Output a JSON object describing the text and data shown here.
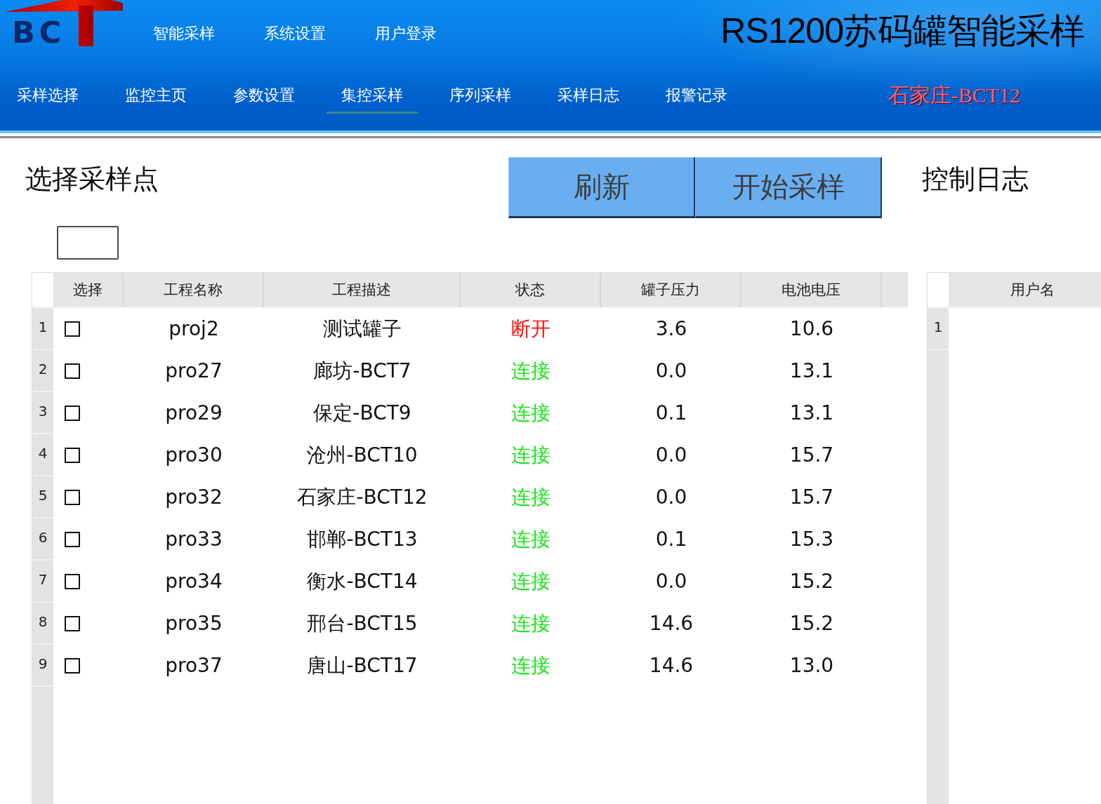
{
  "header": {
    "logo": "BC",
    "menu": [
      "智能采样",
      "系统设置",
      "用户登录"
    ],
    "title": "RS1200苏码罐智能采样",
    "tabs": [
      {
        "label": "采样选择",
        "selected": false
      },
      {
        "label": "监控主页",
        "selected": false
      },
      {
        "label": "参数设置",
        "selected": false
      },
      {
        "label": "集控采样",
        "selected": true
      },
      {
        "label": "序列采样",
        "selected": false
      },
      {
        "label": "采样日志",
        "selected": false
      },
      {
        "label": "报警记录",
        "selected": false
      }
    ],
    "location": "石家庄-BCT12"
  },
  "sample_panel": {
    "title": "选择采样点",
    "buttons": [
      "刷新",
      "开始采样"
    ],
    "table": {
      "columns": [
        "选择",
        "工程名称",
        "工程描述",
        "状态",
        "罐子压力",
        "电池电压"
      ],
      "rows": [
        {
          "number": "1",
          "checked": false,
          "name": "proj2",
          "description": "测试罐子",
          "status": "断开",
          "connected": false,
          "pressure": "3.6",
          "voltage": "10.6"
        },
        {
          "number": "2",
          "checked": false,
          "name": "pro27",
          "description": "廊坊-BCT7",
          "status": "连接",
          "connected": true,
          "pressure": "0.0",
          "voltage": "13.1"
        },
        {
          "number": "3",
          "checked": false,
          "name": "pro29",
          "description": "保定-BCT9",
          "status": "连接",
          "connected": true,
          "pressure": "0.1",
          "voltage": "13.1"
        },
        {
          "number": "4",
          "checked": false,
          "name": "pro30",
          "description": "沧州-BCT10",
          "status": "连接",
          "connected": true,
          "pressure": "0.0",
          "voltage": "15.7"
        },
        {
          "number": "5",
          "checked": false,
          "name": "pro32",
          "description": "石家庄-BCT12",
          "status": "连接",
          "connected": true,
          "pressure": "0.0",
          "voltage": "15.7"
        },
        {
          "number": "6",
          "checked": false,
          "name": "pro33",
          "description": "邯郸-BCT13",
          "status": "连接",
          "connected": true,
          "pressure": "0.1",
          "voltage": "15.3"
        },
        {
          "number": "7",
          "checked": false,
          "name": "pro34",
          "description": "衡水-BCT14",
          "status": "连接",
          "connected": true,
          "pressure": "0.0",
          "voltage": "15.2"
        },
        {
          "number": "8",
          "checked": false,
          "name": "pro35",
          "description": "邢台-BCT15",
          "status": "连接",
          "connected": true,
          "pressure": "14.6",
          "voltage": "15.2"
        },
        {
          "number": "9",
          "checked": false,
          "name": "pro37",
          "description": "唐山-BCT17",
          "status": "连接",
          "connected": true,
          "pressure": "14.6",
          "voltage": "13.0"
        }
      ]
    }
  },
  "log_panel": {
    "title": "控制日志",
    "table": {
      "columns": [
        "用户名"
      ],
      "rows": [
        {
          "number": "1"
        }
      ]
    }
  }
}
